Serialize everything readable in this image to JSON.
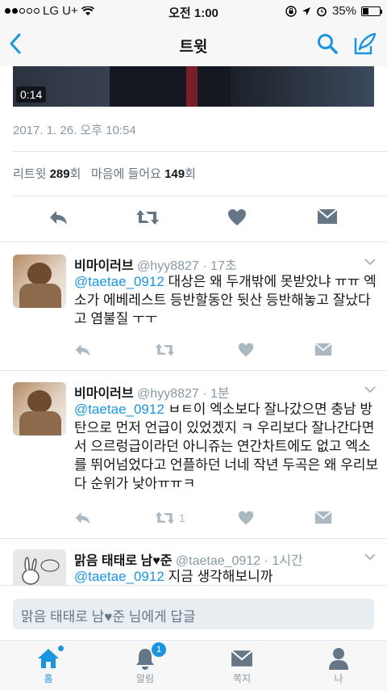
{
  "status_bar": {
    "carrier": "LG U+",
    "time": "오전 1:00",
    "battery": "35%",
    "battery_level": 0.35
  },
  "nav": {
    "title": "트윗"
  },
  "main_tweet": {
    "video_duration": "0:14",
    "timestamp": "2017. 1. 26. 오후 10:54",
    "retweets_label": "리트윗",
    "retweets_count": "289",
    "retweets_unit": "회",
    "likes_label": "마음에 들어요",
    "likes_count": "149",
    "likes_unit": "회"
  },
  "replies": [
    {
      "name": "비마이러브",
      "handle": "@hyy8827",
      "time": "17초",
      "mention": "@taetae_0912",
      "text": " 대상은 왜 두개밖에 못받았냐 ㅠㅠ 엑소가 에베레스트 등반할동안 뒷산 등반해놓고 잘났다고 염불질 ㅜㅜ",
      "retweet_count": ""
    },
    {
      "name": "비마이러브",
      "handle": "@hyy8827",
      "time": "1분",
      "mention": "@taetae_0912",
      "text": " ㅂㅌ이 엑소보다 잘나갔으면 충남 방탄으로 먼저 언급이 있었겠지 ㅋ 우리보다 잘나간다면서 으르렁급이라던 아니쥬는 연간차트에도 없고 엑소를 뛰어넘었다고 언플하던 너네 작년 두곡은 왜 우리보다 순위가 낮아ㅠㅠㅋ",
      "retweet_count": "1"
    },
    {
      "name": "맑음 태태로 남♥준",
      "handle": "@taetae_0912",
      "time": "1시간",
      "mention": "@taetae_0912",
      "text": " 지금 생각해보니까",
      "retweet_count": ""
    }
  ],
  "reply_box": {
    "placeholder": "맑음 태태로 남♥준 님에게 답글"
  },
  "tabs": {
    "home": "홈",
    "notifications": "알림",
    "notifications_badge": "1",
    "messages": "쪽지",
    "me": "나"
  },
  "colors": {
    "accent": "#1b95e0",
    "icon_gray": "#657786",
    "light_gray": "#aab8c2"
  },
  "icons": [
    "back-icon",
    "search-icon",
    "compose-icon",
    "reply-icon",
    "retweet-icon",
    "heart-icon",
    "dm-icon",
    "chevron-down-icon",
    "home-icon",
    "bell-icon",
    "envelope-icon",
    "person-icon"
  ]
}
